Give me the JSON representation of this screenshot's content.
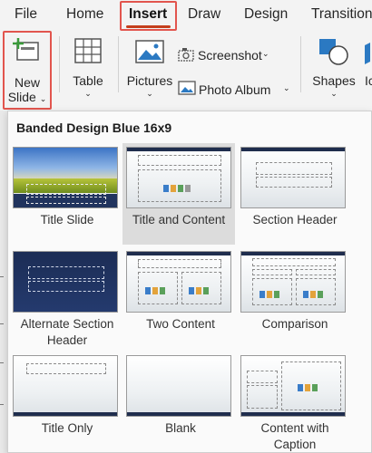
{
  "tabs": [
    {
      "label": "File"
    },
    {
      "label": "Home"
    },
    {
      "label": "Insert"
    },
    {
      "label": "Draw"
    },
    {
      "label": "Design"
    },
    {
      "label": "Transitions"
    }
  ],
  "ribbon": {
    "new_slide_line1": "New",
    "new_slide_line2": "Slide",
    "table": "Table",
    "pictures": "Pictures",
    "screenshot": "Screenshot",
    "photo_album": "Photo Album",
    "shapes": "Shapes",
    "icons_partial": "Ic"
  },
  "colors": {
    "highlight": "#e2554e",
    "accent": "#c43e1c",
    "theme_dark": "#1f2d4d"
  },
  "panel": {
    "title": "Banded Design Blue 16x9",
    "layouts": [
      {
        "line1": "Title Slide",
        "line2": ""
      },
      {
        "line1": "Title and Content",
        "line2": ""
      },
      {
        "line1": "Section Header",
        "line2": ""
      },
      {
        "line1": "Alternate Section",
        "line2": "Header"
      },
      {
        "line1": "Two Content",
        "line2": ""
      },
      {
        "line1": "Comparison",
        "line2": ""
      },
      {
        "line1": "Title Only",
        "line2": ""
      },
      {
        "line1": "Blank",
        "line2": ""
      },
      {
        "line1": "Content with",
        "line2": "Caption"
      }
    ]
  }
}
